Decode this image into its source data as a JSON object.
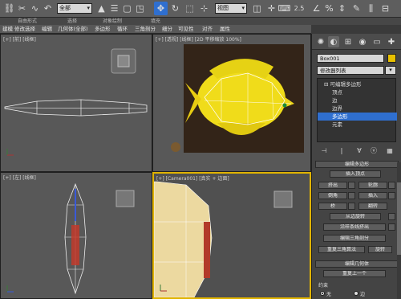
{
  "toolbar": {
    "selection_filter": "全部",
    "view_dropdown": "视图",
    "snap_value": "2.5",
    "icons": [
      "link-icon",
      "unlink-icon",
      "bind-space-warp-icon",
      "select-object-icon",
      "select-by-name-icon",
      "rect-select-icon",
      "window-crossing-icon",
      "move-icon",
      "rotate-icon",
      "scale-icon",
      "pivot-icon",
      "manipulate-icon",
      "snap-icon",
      "angle-snap-icon",
      "percent-snap-icon",
      "spinner-snap-icon",
      "edit-named-selection-icon",
      "mirror-icon"
    ]
  },
  "ribbon_tabs": [
    "自由形式",
    "选择",
    "对象绘制",
    "填充"
  ],
  "sub_tabs": [
    "建模",
    "修改选择",
    "编辑",
    "几何体(全部)",
    "多边形",
    "循环",
    "三角剖分",
    "细分",
    "可见性",
    "对齐",
    "属性"
  ],
  "viewports": {
    "front": "[+] [前] [线框]",
    "perspective": "[+] [透视] [线框] [2D 平移缩放 100%]",
    "left": "[+] [左] [线框]",
    "camera": "[+] [Camera001] [真实 + 边面]"
  },
  "panel": {
    "object_name": "Box001",
    "modifier_list": "修改器列表",
    "stack": [
      "可编辑多边形",
      "顶点",
      "边",
      "边界",
      "多边形",
      "元素"
    ],
    "stack_selected_index": 4,
    "rollouts": {
      "edit_polygons": {
        "title": "编辑多边形",
        "insert_vertex": "插入顶点",
        "extrude": "挤出",
        "outline": "轮廓",
        "bevel": "倒角",
        "inset": "插入",
        "bridge": "桥",
        "flip": "翻转",
        "hinge_from_edge": "从边旋转",
        "extrude_along_spline": "沿样条线挤出",
        "edit_triangulation": "编辑三角剖分",
        "retriangulate": "重复三角算法",
        "turn": "旋转"
      },
      "edit_geometry": {
        "title": "编辑几何体",
        "repeat_last": "重复上一个",
        "constraints_label": "约束",
        "constraint_none": "无",
        "constraint_edge": "边"
      }
    }
  },
  "colors": {
    "selection_blue": "#2f6fcf",
    "object_color": "#e8c000",
    "active_viewport_border": "#e0b300"
  }
}
